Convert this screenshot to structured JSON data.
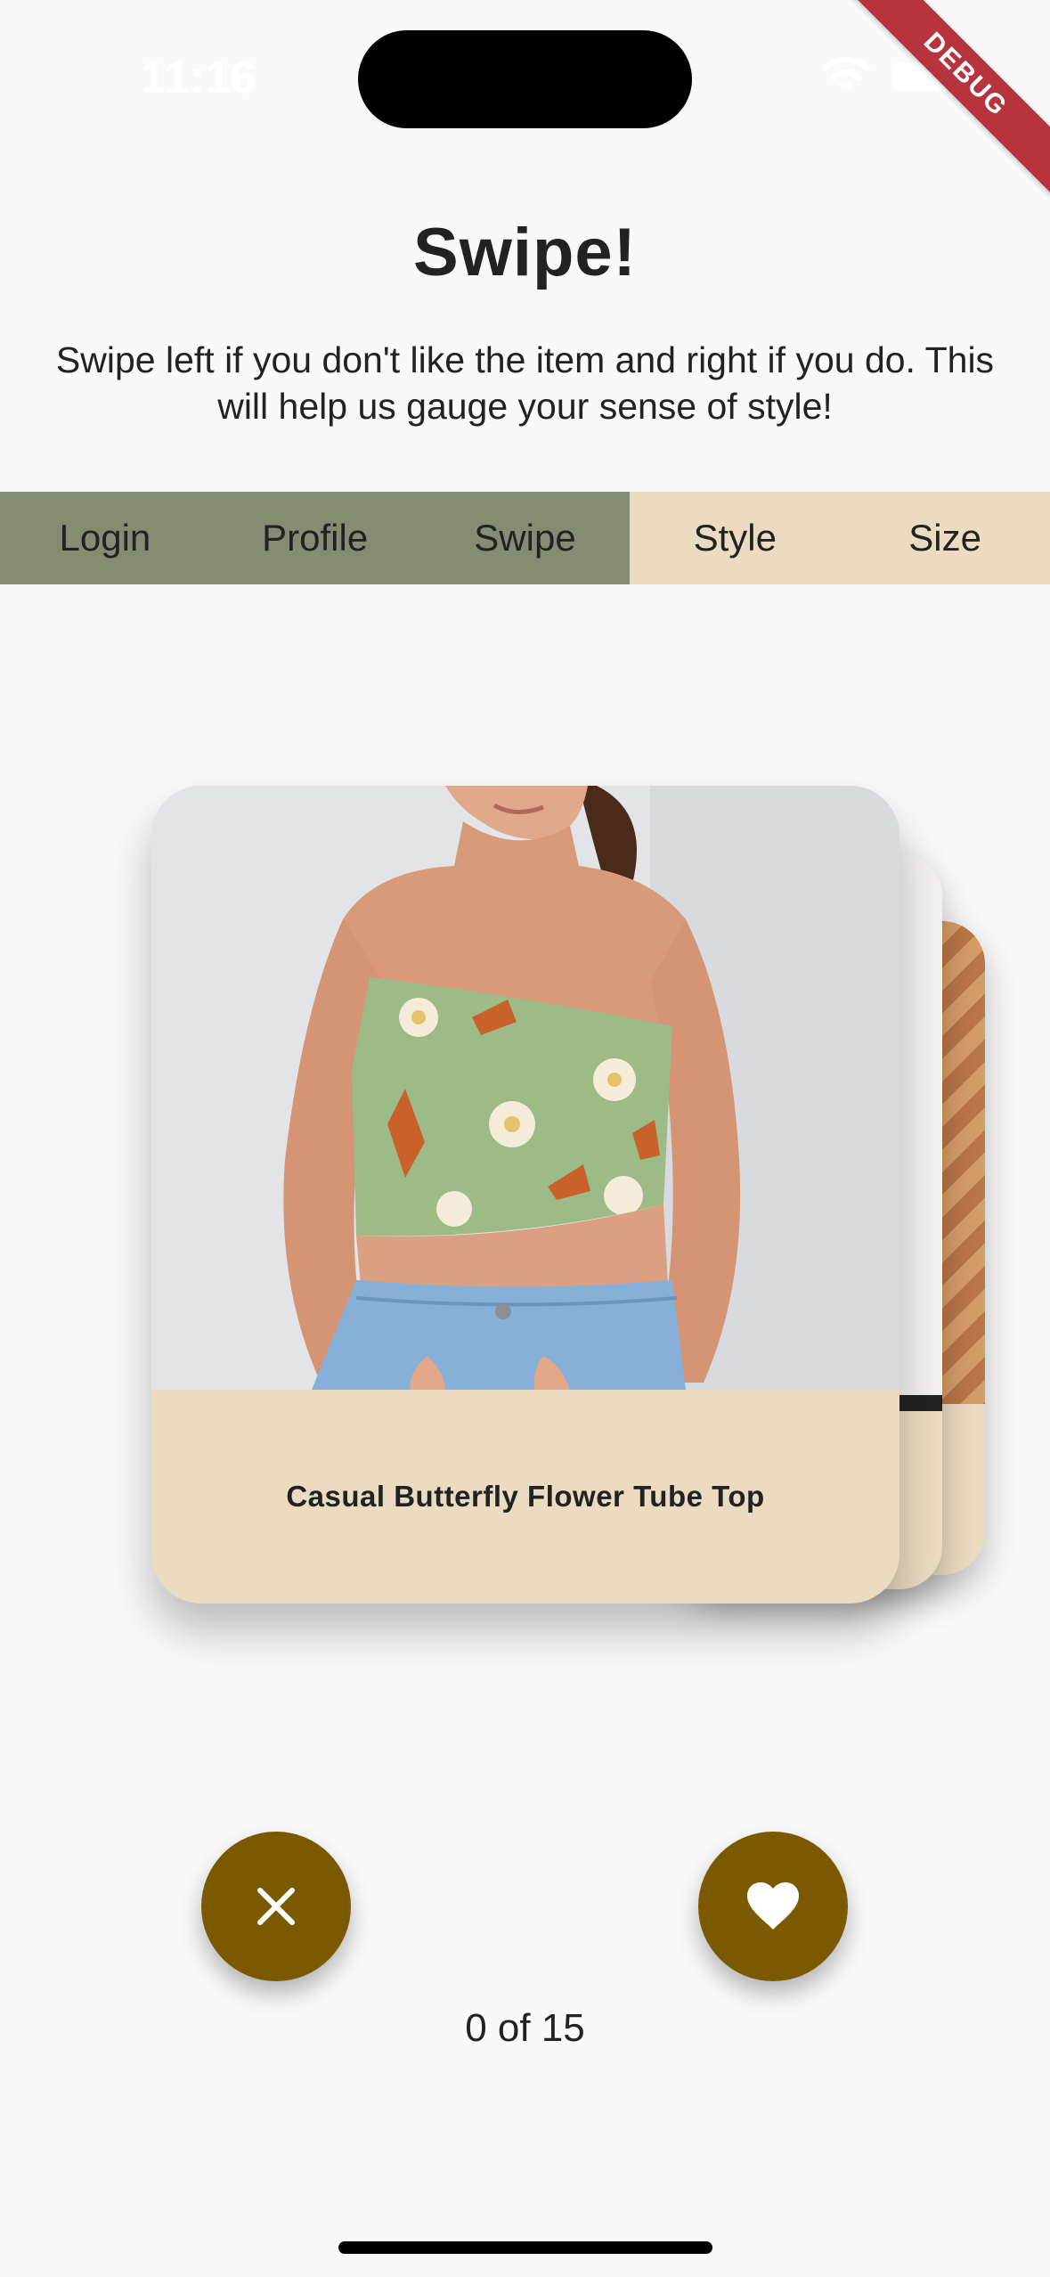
{
  "status_bar": {
    "time": "11:16",
    "debug_label": "DEBUG"
  },
  "header": {
    "title": "Swipe!",
    "subtitle": "Swipe left if you don't like the item and right if you do. This will help us gauge your sense of style!"
  },
  "nav": {
    "tabs": [
      {
        "label": "Login",
        "state": "completed"
      },
      {
        "label": "Profile",
        "state": "completed"
      },
      {
        "label": "Swipe",
        "state": "current"
      },
      {
        "label": "Style",
        "state": "upcoming"
      },
      {
        "label": "Size",
        "state": "upcoming"
      }
    ]
  },
  "card": {
    "title": "Casual Butterfly Flower Tube Top",
    "image": "model wearing green butterfly and flower print tube top with jeans"
  },
  "actions": {
    "dislike_icon": "close-icon",
    "like_icon": "heart-icon"
  },
  "progress": {
    "current": 0,
    "total": 15,
    "label": "0 of 15"
  },
  "colors": {
    "background": "#f9f9f9",
    "tab_completed": "#858c72",
    "tab_upcoming": "#ebdcc1",
    "card_footer": "#ebdcc1",
    "button": "#7a5900",
    "debug_banner": "#b5343d"
  }
}
